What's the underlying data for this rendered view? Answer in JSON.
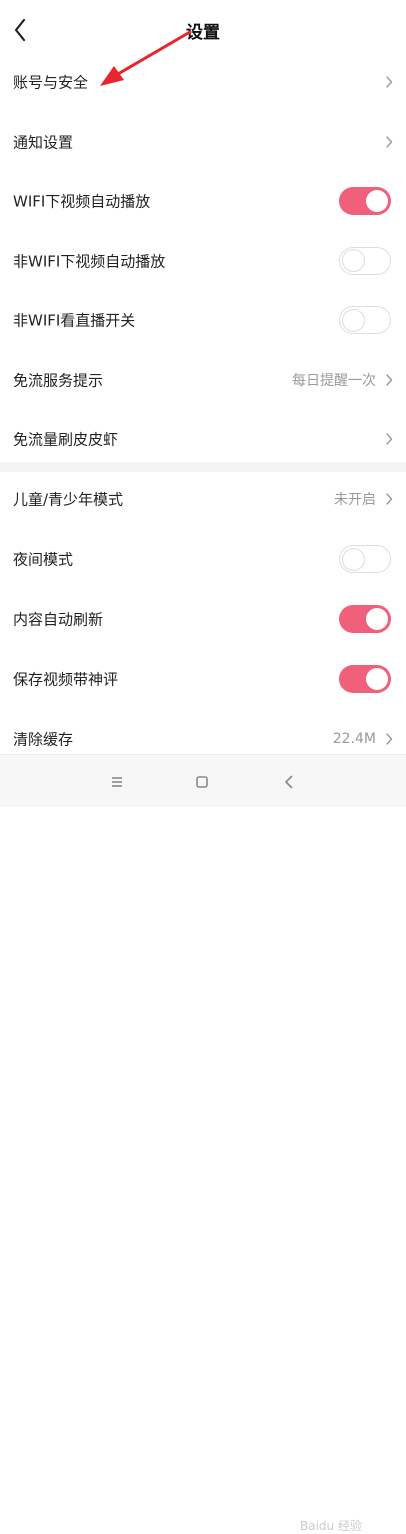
{
  "header": {
    "title": "设置"
  },
  "settings_top": [
    {
      "label": "账号与安全",
      "type": "link"
    },
    {
      "label": "通知设置",
      "type": "link"
    },
    {
      "label": "WIFI下视频自动播放",
      "type": "toggle",
      "on": true
    },
    {
      "label": "非WIFI下视频自动播放",
      "type": "toggle",
      "on": false
    },
    {
      "label": "非WIFI看直播开关",
      "type": "toggle",
      "on": false
    },
    {
      "label": "免流服务提示",
      "type": "link",
      "value": "每日提醒一次"
    },
    {
      "label": "免流量刷皮皮虾",
      "type": "link"
    }
  ],
  "settings_bottom": [
    {
      "label": "儿童/青少年模式",
      "type": "link",
      "value": "未开启"
    },
    {
      "label": "夜间模式",
      "type": "toggle",
      "on": false
    },
    {
      "label": "内容自动刷新",
      "type": "toggle",
      "on": true
    },
    {
      "label": "保存视频带神评",
      "type": "toggle",
      "on": true
    },
    {
      "label": "清除缓存",
      "type": "link",
      "value": "22.4M"
    }
  ],
  "colors": {
    "toggle_on": "#f0607a",
    "annotation_arrow": "#e8242c"
  },
  "icons": {
    "back": "back-arrow-icon",
    "chevron": "chevron-right-icon",
    "nav_menu": "menu-icon",
    "nav_home": "home-square-icon",
    "nav_back": "back-triangle-icon"
  },
  "watermark": "Baidu 经验"
}
